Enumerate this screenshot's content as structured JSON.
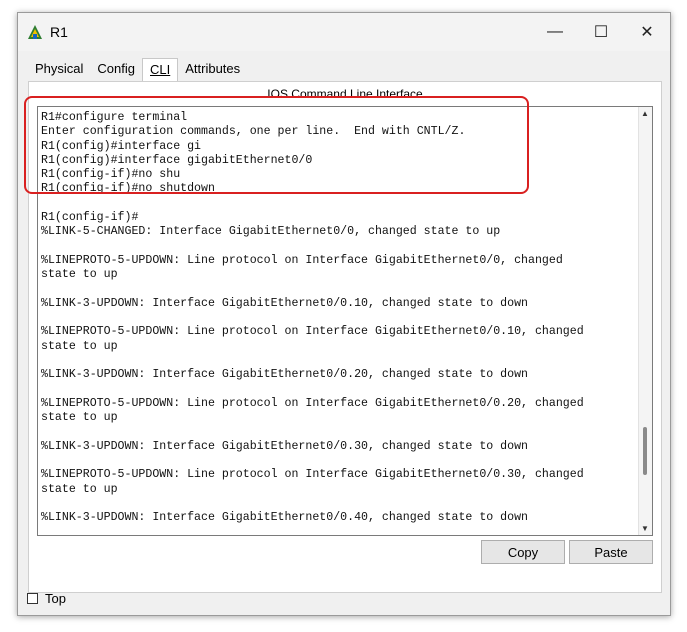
{
  "window": {
    "title": "R1",
    "icon": "router-app-icon"
  },
  "controls": {
    "minimize": "—",
    "maximize": "☐",
    "close": "✕"
  },
  "tabs": [
    {
      "label": "Physical"
    },
    {
      "label": "Config"
    },
    {
      "label": "CLI",
      "active": true
    },
    {
      "label": "Attributes"
    }
  ],
  "cli": {
    "section_title": "IOS Command Line Interface",
    "lines": [
      "R1#configure terminal",
      "Enter configuration commands, one per line.  End with CNTL/Z.",
      "R1(config)#interface gi",
      "R1(config)#interface gigabitEthernet0/0",
      "R1(config-if)#no shu",
      "R1(config-if)#no shutdown",
      "",
      "R1(config-if)#",
      "%LINK-5-CHANGED: Interface GigabitEthernet0/0, changed state to up",
      "",
      "%LINEPROTO-5-UPDOWN: Line protocol on Interface GigabitEthernet0/0, changed",
      "state to up",
      "",
      "%LINK-3-UPDOWN: Interface GigabitEthernet0/0.10, changed state to down",
      "",
      "%LINEPROTO-5-UPDOWN: Line protocol on Interface GigabitEthernet0/0.10, changed",
      "state to up",
      "",
      "%LINK-3-UPDOWN: Interface GigabitEthernet0/0.20, changed state to down",
      "",
      "%LINEPROTO-5-UPDOWN: Line protocol on Interface GigabitEthernet0/0.20, changed",
      "state to up",
      "",
      "%LINK-3-UPDOWN: Interface GigabitEthernet0/0.30, changed state to down",
      "",
      "%LINEPROTO-5-UPDOWN: Line protocol on Interface GigabitEthernet0/0.30, changed",
      "state to up",
      "",
      "%LINK-3-UPDOWN: Interface GigabitEthernet0/0.40, changed state to down"
    ]
  },
  "buttons": {
    "copy": "Copy",
    "paste": "Paste"
  },
  "footer": {
    "top_label": "Top",
    "top_checked": false
  },
  "colors": {
    "highlight": "#d92020"
  }
}
